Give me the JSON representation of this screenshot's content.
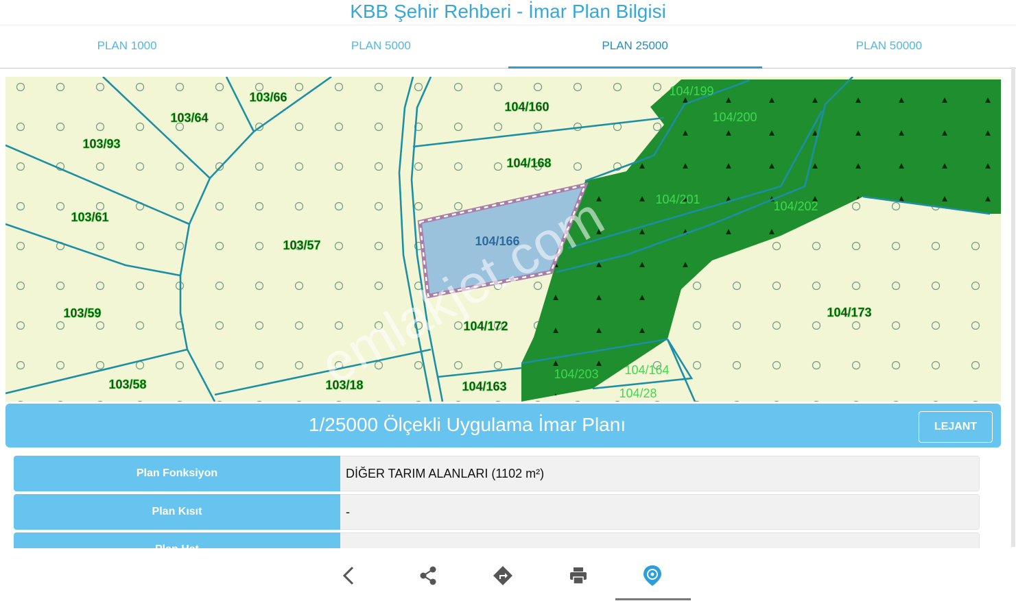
{
  "app_title": "KBB Şehir Rehberi - İmar Plan Bilgisi",
  "tabs": [
    {
      "label": "PLAN 1000",
      "active": false
    },
    {
      "label": "PLAN 5000",
      "active": false
    },
    {
      "label": "PLAN 25000",
      "active": true
    },
    {
      "label": "PLAN 50000",
      "active": false
    }
  ],
  "map": {
    "watermark": "emlakjet.com",
    "parcels": [
      "103/66",
      "103/64",
      "103/93",
      "103/61",
      "103/57",
      "103/59",
      "103/58",
      "103/18",
      "104/160",
      "104/168",
      "104/166",
      "104/172",
      "104/163",
      "104/199",
      "104/200",
      "104/201",
      "104/202",
      "104/173",
      "104/203",
      "104/164",
      "104/28"
    ],
    "colors": {
      "agriculture": "#f3f6d4",
      "forest": "#1f8e2f",
      "selected": "#9bc2dc",
      "parcel_line": "#1d8fa5",
      "selected_border": "#a87ea8"
    }
  },
  "plan": {
    "title": "1/25000 Ölçekli Uygulama İmar Planı",
    "lejant_label": "LEJANT"
  },
  "info_rows": [
    {
      "label": "Plan Fonksiyon",
      "value": "DİĞER TARIM ALANLARI (1102 m²)"
    },
    {
      "label": "Plan Kısıt",
      "value": "-"
    },
    {
      "label": "Plan Hat",
      "value": ""
    }
  ],
  "bottom_bar": {
    "icons": [
      "back-icon",
      "share-icon",
      "directions-icon",
      "print-icon",
      "location-icon"
    ],
    "accent": "#2a9fd8"
  }
}
